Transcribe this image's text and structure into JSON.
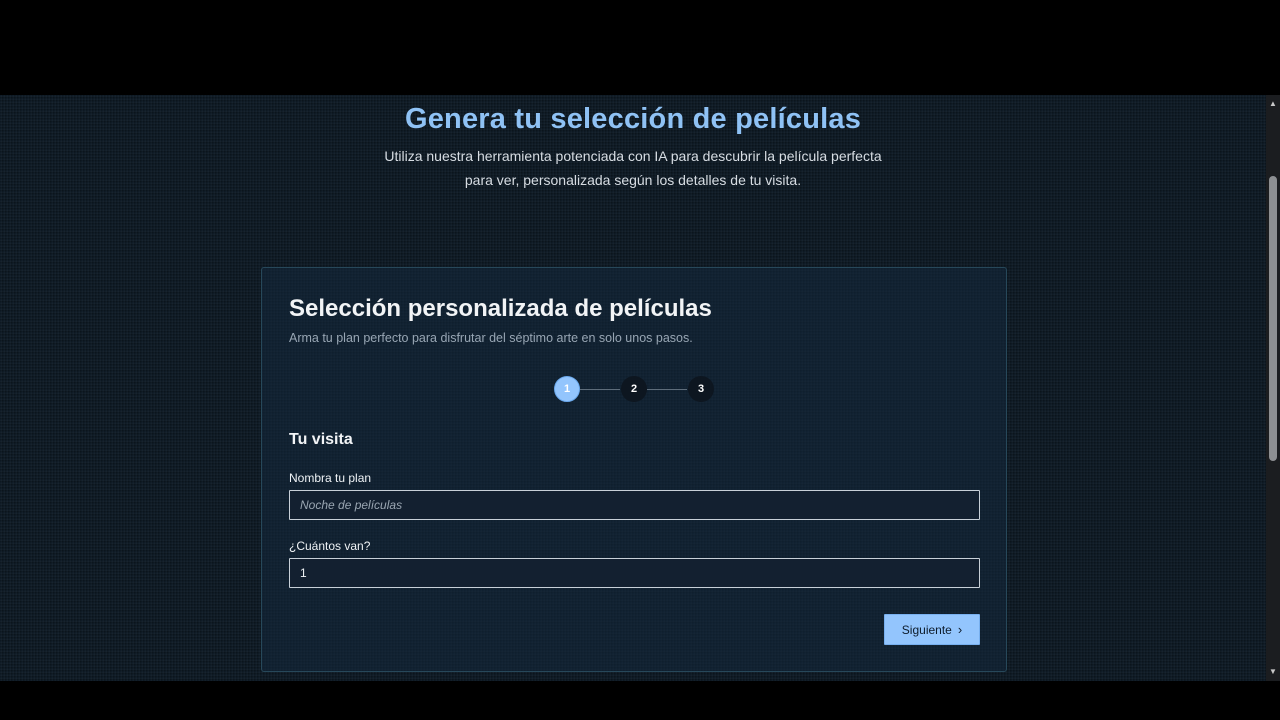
{
  "hero": {
    "title": "Genera tu selección de películas",
    "subtitle_line1": "Utiliza nuestra herramienta potenciada con IA para descubrir la película perfecta",
    "subtitle_line2": "para ver, personalizada según los detalles de tu visita."
  },
  "card": {
    "title": "Selección personalizada de películas",
    "subtitle": "Arma tu plan perfecto para disfrutar del séptimo arte en solo unos pasos."
  },
  "stepper": {
    "current_step": 1,
    "steps": [
      {
        "label": "1"
      },
      {
        "label": "2"
      },
      {
        "label": "3"
      }
    ]
  },
  "section": {
    "title": "Tu visita"
  },
  "form": {
    "plan_name": {
      "label": "Nombra tu plan",
      "placeholder": "Noche de películas",
      "value": ""
    },
    "count": {
      "label": "¿Cuántos van?",
      "value": "1"
    }
  },
  "actions": {
    "next_label": "Siguiente",
    "next_icon": "chevron-right-icon"
  },
  "colors": {
    "accent": "#93c5fd",
    "background": "#0f1b26",
    "card_border": "#27485a"
  }
}
